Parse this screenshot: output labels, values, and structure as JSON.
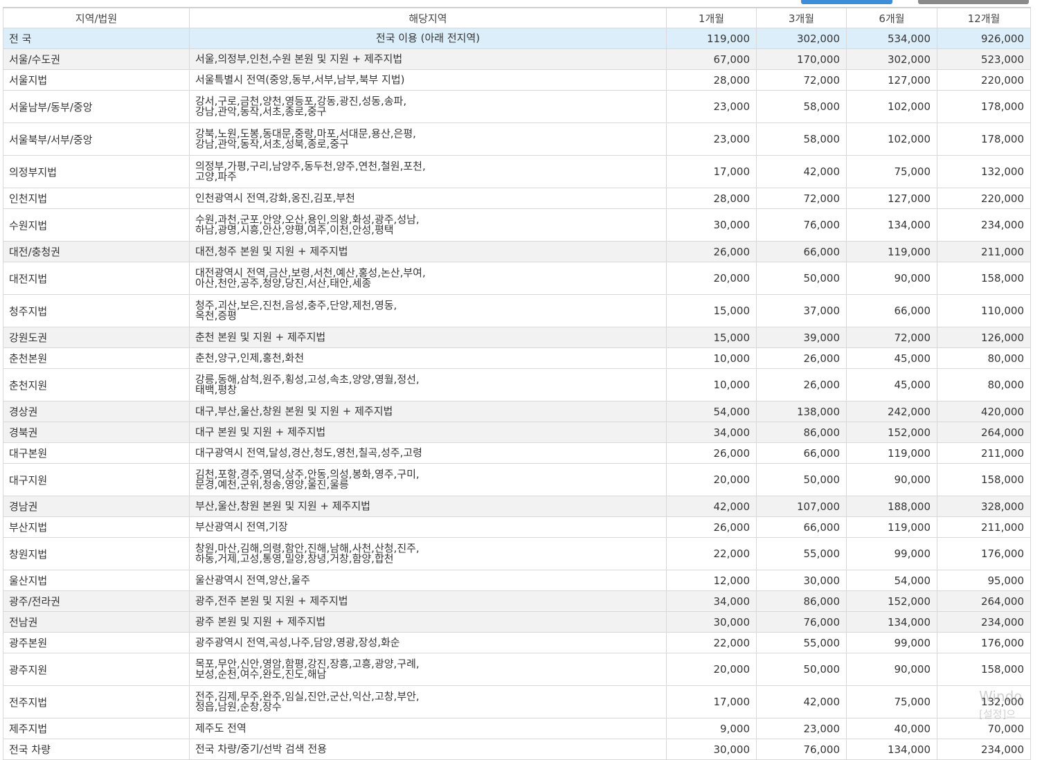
{
  "table": {
    "headers": [
      "지역/법원",
      "해당지역",
      "1개월",
      "3개월",
      "6개월",
      "12개월"
    ],
    "rows": [
      {
        "region": "전 국",
        "area": "전국 이용 (아래 전지역)",
        "m1": "119,000",
        "m3": "302,000",
        "m6": "534,000",
        "m12": "926,000",
        "style": "hl",
        "lines": 1
      },
      {
        "region": "서울/수도권",
        "area": "서울,의정부,인천,수원 본원 및 지원 + 제주지법",
        "m1": "67,000",
        "m3": "170,000",
        "m6": "302,000",
        "m12": "523,000",
        "style": "reg",
        "lines": 1
      },
      {
        "region": "서울지법",
        "area": "서울특별시 전역(중앙,동부,서부,남부,북부 지법)",
        "m1": "28,000",
        "m3": "72,000",
        "m6": "127,000",
        "m12": "220,000",
        "style": "",
        "lines": 1
      },
      {
        "region": "서울남부/동부/중앙",
        "area": "강서,구로,금천,양천,영등포,강동,광진,성동,송파,\n강남,관악,동작,서초,종로,중구",
        "m1": "23,000",
        "m3": "58,000",
        "m6": "102,000",
        "m12": "178,000",
        "style": "",
        "lines": 2
      },
      {
        "region": "서울북부/서부/중앙",
        "area": "강북,노원,도봉,동대문,중랑,마포,서대문,용산,은평,\n강남,관악,동작,서초,성북,종로,중구",
        "m1": "23,000",
        "m3": "58,000",
        "m6": "102,000",
        "m12": "178,000",
        "style": "",
        "lines": 2
      },
      {
        "region": "의정부지법",
        "area": "의정부,가평,구리,남양주,동두천,양주,연천,철원,포천,\n고양,파주",
        "m1": "17,000",
        "m3": "42,000",
        "m6": "75,000",
        "m12": "132,000",
        "style": "",
        "lines": 2
      },
      {
        "region": "인천지법",
        "area": "인천광역시 전역,강화,옹진,김포,부천",
        "m1": "28,000",
        "m3": "72,000",
        "m6": "127,000",
        "m12": "220,000",
        "style": "",
        "lines": 1
      },
      {
        "region": "수원지법",
        "area": "수원,과천,군포,안양,오산,용인,의왕,화성,광주,성남,\n하남,광명,시흥,안산,양평,여주,이천,안성,평택",
        "m1": "30,000",
        "m3": "76,000",
        "m6": "134,000",
        "m12": "234,000",
        "style": "",
        "lines": 2
      },
      {
        "region": "대전/충청권",
        "area": "대전,청주 본원 및 지원 + 제주지법",
        "m1": "26,000",
        "m3": "66,000",
        "m6": "119,000",
        "m12": "211,000",
        "style": "reg",
        "lines": 1
      },
      {
        "region": "대전지법",
        "area": "대전광역시 전역,금산,보령,서천,예산,홍성,논산,부여,\n아산,천안,공주,청양,당진,서산,태안,세종",
        "m1": "20,000",
        "m3": "50,000",
        "m6": "90,000",
        "m12": "158,000",
        "style": "",
        "lines": 2
      },
      {
        "region": "청주지법",
        "area": "청주,괴산,보은,진천,음성,충주,단양,제천,영동,\n옥천,증평",
        "m1": "15,000",
        "m3": "37,000",
        "m6": "66,000",
        "m12": "110,000",
        "style": "",
        "lines": 2
      },
      {
        "region": "강원도권",
        "area": "춘천 본원 및 지원 + 제주지법",
        "m1": "15,000",
        "m3": "39,000",
        "m6": "72,000",
        "m12": "126,000",
        "style": "reg",
        "lines": 1
      },
      {
        "region": "춘천본원",
        "area": "춘천,양구,인제,홍천,화천",
        "m1": "10,000",
        "m3": "26,000",
        "m6": "45,000",
        "m12": "80,000",
        "style": "",
        "lines": 1
      },
      {
        "region": "춘천지원",
        "area": "강릉,동해,삼척,원주,횡성,고성,속초,양양,영월,정선,\n태백,평창",
        "m1": "10,000",
        "m3": "26,000",
        "m6": "45,000",
        "m12": "80,000",
        "style": "",
        "lines": 2
      },
      {
        "region": "경상권",
        "area": "대구,부산,울산,창원 본원 및 지원 + 제주지법",
        "m1": "54,000",
        "m3": "138,000",
        "m6": "242,000",
        "m12": "420,000",
        "style": "reg",
        "lines": 1
      },
      {
        "region": "경북권",
        "area": "대구 본원 및 지원 + 제주지법",
        "m1": "34,000",
        "m3": "86,000",
        "m6": "152,000",
        "m12": "264,000",
        "style": "reg",
        "lines": 1
      },
      {
        "region": "대구본원",
        "area": "대구광역시 전역,달성,경산,청도,영천,칠곡,성주,고령",
        "m1": "26,000",
        "m3": "66,000",
        "m6": "119,000",
        "m12": "211,000",
        "style": "",
        "lines": 1
      },
      {
        "region": "대구지원",
        "area": "김천,포항,경주,영덕,상주,안동,의성,봉화,영주,구미,\n문경,예천,군위,청송,영양,울진,울릉",
        "m1": "20,000",
        "m3": "50,000",
        "m6": "90,000",
        "m12": "158,000",
        "style": "",
        "lines": 2
      },
      {
        "region": "경남권",
        "area": "부산,울산,창원 본원 및 지원 + 제주지법",
        "m1": "42,000",
        "m3": "107,000",
        "m6": "188,000",
        "m12": "328,000",
        "style": "reg",
        "lines": 1
      },
      {
        "region": "부산지법",
        "area": "부산광역시 전역,기장",
        "m1": "26,000",
        "m3": "66,000",
        "m6": "119,000",
        "m12": "211,000",
        "style": "",
        "lines": 1
      },
      {
        "region": "창원지법",
        "area": "창원,마산,김해,의령,함안,진해,남해,사천,산청,진주,\n하동,거제,고성,통영,밀양,창녕,거창,함양,합천",
        "m1": "22,000",
        "m3": "55,000",
        "m6": "99,000",
        "m12": "176,000",
        "style": "",
        "lines": 2
      },
      {
        "region": "울산지법",
        "area": "울산광역시 전역,양산,울주",
        "m1": "12,000",
        "m3": "30,000",
        "m6": "54,000",
        "m12": "95,000",
        "style": "",
        "lines": 1
      },
      {
        "region": "광주/전라권",
        "area": "광주,전주 본원 및 지원 + 제주지법",
        "m1": "34,000",
        "m3": "86,000",
        "m6": "152,000",
        "m12": "264,000",
        "style": "reg",
        "lines": 1
      },
      {
        "region": "전남권",
        "area": "광주 본원 및 지원 + 제주지법",
        "m1": "30,000",
        "m3": "76,000",
        "m6": "134,000",
        "m12": "234,000",
        "style": "reg",
        "lines": 1
      },
      {
        "region": "광주본원",
        "area": "광주광역시 전역,곡성,나주,담양,영광,장성,화순",
        "m1": "22,000",
        "m3": "55,000",
        "m6": "99,000",
        "m12": "176,000",
        "style": "",
        "lines": 1
      },
      {
        "region": "광주지원",
        "area": "목포,무안,신안,영암,함평,강진,장흥,고흥,광양,구례,\n보성,순천,여수,완도,진도,해남",
        "m1": "20,000",
        "m3": "50,000",
        "m6": "90,000",
        "m12": "158,000",
        "style": "",
        "lines": 2
      },
      {
        "region": "전주지법",
        "area": "전주,김제,무주,완주,임실,진안,군산,익산,고창,부안,\n정읍,남원,순창,장수",
        "m1": "17,000",
        "m3": "42,000",
        "m6": "75,000",
        "m12": "132,000",
        "style": "",
        "lines": 2
      },
      {
        "region": "제주지법",
        "area": "제주도 전역",
        "m1": "9,000",
        "m3": "23,000",
        "m6": "40,000",
        "m12": "70,000",
        "style": "",
        "lines": 1
      },
      {
        "region": "전국 차량",
        "area": "전국 차량/중기/선박 검색 전용",
        "m1": "30,000",
        "m3": "76,000",
        "m6": "134,000",
        "m12": "234,000",
        "style": "",
        "lines": 1
      }
    ]
  },
  "watermark": {
    "line1": "Windo",
    "line2": "[설정]으"
  },
  "colors": {
    "highlight_row": "#ddeefb",
    "region_row": "#f2f2f2",
    "border": "#d8d8d8"
  }
}
